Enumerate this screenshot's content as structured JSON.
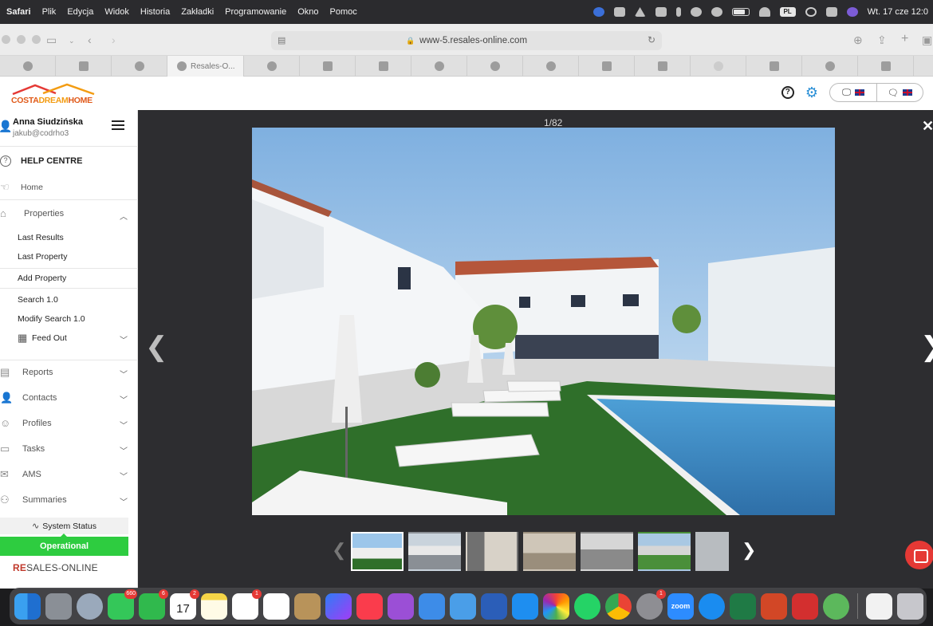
{
  "menubar": {
    "app_name": "Safari",
    "items": [
      "Plik",
      "Edycja",
      "Widok",
      "Historia",
      "Zakładki",
      "Programowanie",
      "Okno",
      "Pomoc"
    ],
    "input_source": "PL",
    "clock": "Wt. 17 cze  12:0"
  },
  "browser": {
    "url": "www-5.resales-online.com",
    "active_tab_title": "Resales-O..."
  },
  "site": {
    "brand_part1": "COSTA",
    "brand_part2": "DREAM",
    "brand_part3": "HOME",
    "help_icon": "question-icon",
    "settings_icon": "gear-icon"
  },
  "sidebar": {
    "user_name": "Anna Siudzińska",
    "user_email": "jakub@codrho3",
    "help_centre": "HELP CENTRE",
    "home": "Home",
    "properties": "Properties",
    "last_results": "Last Results",
    "last_property": "Last Property",
    "add_property": "Add Property",
    "search": "Search 1.0",
    "modify_search": "Modify Search 1.0",
    "feed_out": "Feed Out",
    "reports": "Reports",
    "contacts": "Contacts",
    "profiles": "Profiles",
    "tasks": "Tasks",
    "ams": "AMS",
    "summaries": "Summaries",
    "system_status": "System Status",
    "operational": "Operational",
    "footer_brand_red": "RE",
    "footer_brand_rest": "SALES-ONLINE",
    "status_color": "#2ecc40"
  },
  "viewer": {
    "counter": "1/82"
  },
  "dock": {
    "badges": {
      "messages": "660",
      "facetime": "6",
      "calendar": "2",
      "reminders": "1",
      "settings": "1"
    },
    "calendar_day": "17",
    "zoom_label": "zoom"
  }
}
